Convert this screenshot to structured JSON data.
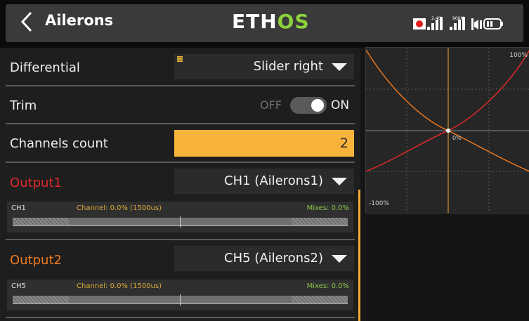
{
  "header": {
    "back_icon": "chevron-left-icon",
    "title": "Ailerons",
    "logo_part1": "ETH",
    "logo_part2": "OS",
    "status_icons": [
      "record-icon",
      "signal-2.4g-icon",
      "signal-900m-icon",
      "speaker-icon",
      "battery-icon"
    ],
    "status_labels": {
      "band1": "2.4G",
      "band2": "900M"
    }
  },
  "form": {
    "differential": {
      "label": "Differential",
      "value": "Slider right"
    },
    "trim": {
      "label": "Trim",
      "off_label": "OFF",
      "on_label": "ON",
      "state": "on"
    },
    "channels_count": {
      "label": "Channels count",
      "value": "2"
    },
    "outputs": [
      {
        "label": "Output1",
        "color": "#e02a2a",
        "value": "CH1 (Ailerons1)",
        "channel": "CH1",
        "info": "Channel: 0.0% (1500us)",
        "mixes": "Mixes: 0.0%"
      },
      {
        "label": "Output2",
        "color": "#f07a1e",
        "value": "CH5 (Ailerons2)",
        "channel": "CH5",
        "info": "Channel: 0.0% (1500us)",
        "mixes": "Mixes: 0.0%"
      }
    ]
  },
  "graph": {
    "label_top": "100%",
    "label_center": "0%",
    "label_bottom": "-100%",
    "colors": {
      "curve1": "#e02a2a",
      "curve2": "#f07a1e",
      "cursor": "#f7a836"
    }
  },
  "colors": {
    "accent": "#f7b33a",
    "ethos_green": "#8bd13c"
  }
}
